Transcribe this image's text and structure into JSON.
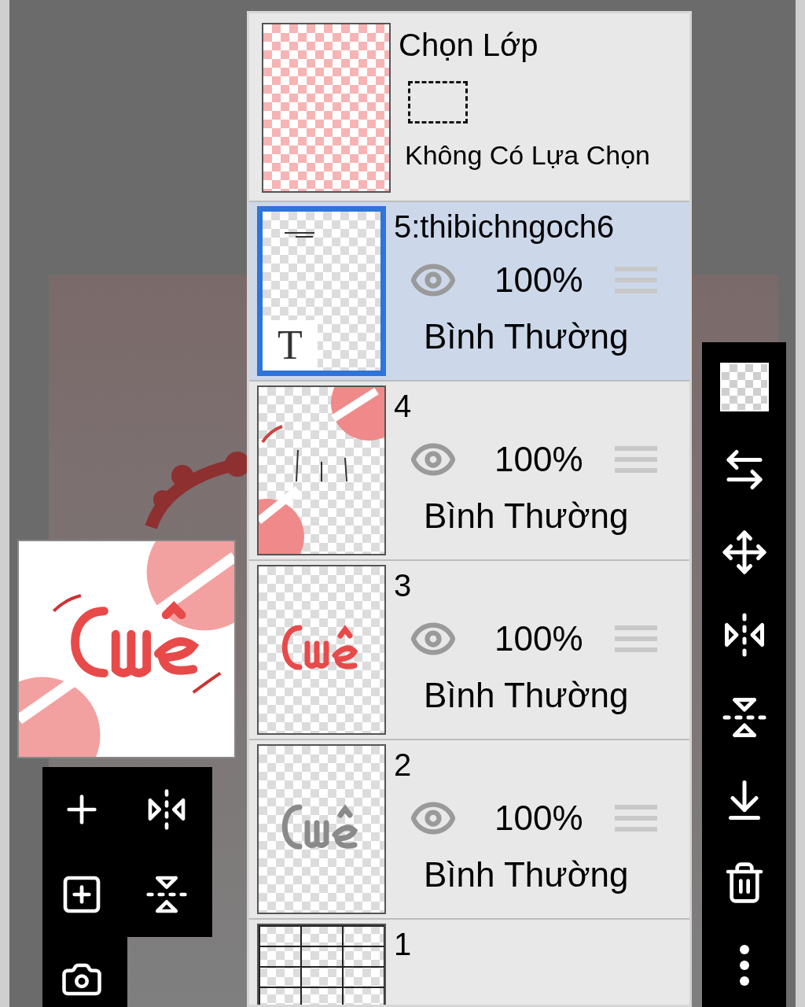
{
  "selection": {
    "title": "Chọn Lớp",
    "status": "Không Có Lựa Chọn"
  },
  "layers": [
    {
      "name": "5:thibichngoch6",
      "badge": "T",
      "selected": true,
      "visible": true,
      "opacity": "100%",
      "blend": "Bình Thường"
    },
    {
      "name": "4",
      "selected": false,
      "visible": true,
      "opacity": "100%",
      "blend": "Bình Thường"
    },
    {
      "name": "3",
      "selected": false,
      "visible": true,
      "opacity": "100%",
      "blend": "Bình Thường"
    },
    {
      "name": "2",
      "selected": false,
      "visible": true,
      "opacity": "100%",
      "blend": "Bình Thường"
    },
    {
      "name": "1",
      "selected": false
    }
  ]
}
